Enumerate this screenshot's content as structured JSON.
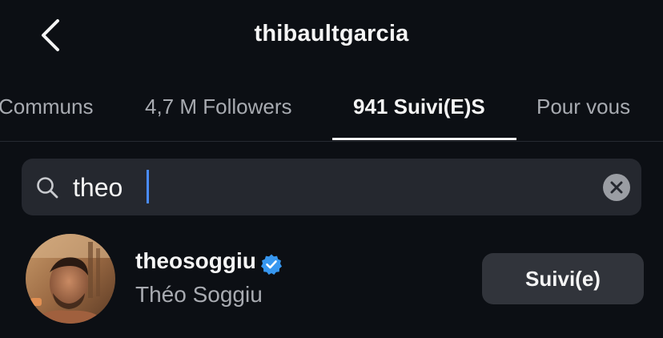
{
  "header": {
    "title": "thibaultgarcia",
    "back_icon": "chevron-left-icon"
  },
  "tabs": [
    {
      "label": "Communs",
      "active": false
    },
    {
      "label": "4,7 M Followers",
      "active": false
    },
    {
      "label": "941 Suivi(E)S",
      "active": true
    },
    {
      "label": "Pour vous",
      "active": false
    }
  ],
  "search": {
    "value": "theo",
    "icon": "search-icon",
    "clear_icon": "clear-icon"
  },
  "results": [
    {
      "username": "theosoggiu",
      "full_name": "Théo Soggiu",
      "verified": true,
      "follow_label": "Suivi(e)"
    }
  ],
  "colors": {
    "background": "#0c0f14",
    "verified_badge": "#3797f0",
    "button_bg": "#31343b",
    "search_bg": "#25282f"
  }
}
